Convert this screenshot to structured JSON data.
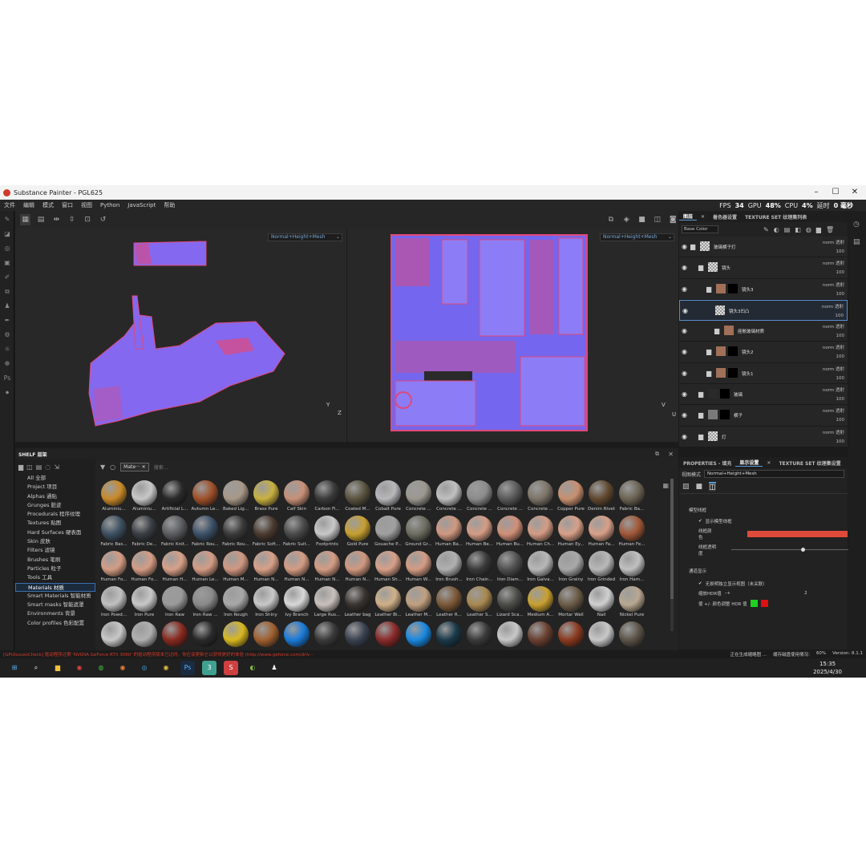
{
  "window": {
    "title": "Substance Painter - PGL625",
    "min": "–",
    "max": "☐",
    "close": "✕"
  },
  "menu": [
    "文件",
    "编辑",
    "模式",
    "窗口",
    "视图",
    "Python",
    "JavaScript",
    "帮助"
  ],
  "stats": {
    "fps_label": "FPS",
    "fps": "34",
    "gpu_label": "GPU",
    "gpu": "48%",
    "cpu_label": "CPU",
    "cpu": "4%",
    "latency_label": "延时",
    "latency": "0 毫秒"
  },
  "viewport": {
    "left_mode": "Normal+Height+Mesh",
    "right_mode": "Normal+Height+Mesh",
    "axis_y": "Y",
    "axis_z": "Z",
    "axis_u": "U",
    "axis_v": "V"
  },
  "shelf": {
    "title": "SHELF 层架",
    "filter_chip": "Mate···",
    "search_placeholder": "搜索...",
    "categories": [
      "All 全部",
      "Project 项目",
      "Alphas 通贴",
      "Grunges 脏迹",
      "Procedurals 程序纹理",
      "Textures 贴图",
      "Hard Surfaces 硬表面",
      "Skin 皮肤",
      "Filters 滤镜",
      "Brushes 笔刷",
      "Particles 粒子",
      "Tools 工具",
      "Materials 材质",
      "Smart Materials 智能材质",
      "Smart masks 智能遮罩",
      "Environments 背景",
      "Color profiles 色彩配置"
    ],
    "selected_category": "Materials 材质",
    "materials": [
      {
        "name": "Aluminiu...",
        "color": "#c98a2a"
      },
      {
        "name": "Aluminiu...",
        "color": "#c8c8c8"
      },
      {
        "name": "Artificial L...",
        "color": "#2a2a2a"
      },
      {
        "name": "Autumn Le...",
        "color": "#a0502a"
      },
      {
        "name": "Baked Lig...",
        "color": "#a89888"
      },
      {
        "name": "Brass Pure",
        "color": "#c8b040"
      },
      {
        "name": "Calf Skin",
        "color": "#c89078"
      },
      {
        "name": "Carbon Fi...",
        "color": "#3a3a3a"
      },
      {
        "name": "Coated M...",
        "color": "#5a5440"
      },
      {
        "name": "Cobalt Pure",
        "color": "#b8b8bc"
      },
      {
        "name": "Concrete ...",
        "color": "#9c9890"
      },
      {
        "name": "Concrete ...",
        "color": "#c0c0c0"
      },
      {
        "name": "Concrete ...",
        "color": "#8c8c8c"
      },
      {
        "name": "Concrete ...",
        "color": "#5a5a5a"
      },
      {
        "name": "Concrete ...",
        "color": "#7c7468"
      },
      {
        "name": "Copper Pure",
        "color": "#c89070"
      },
      {
        "name": "Denim Rivet",
        "color": "#604830"
      },
      {
        "name": "Fabric Ba...",
        "color": "#6c6454"
      },
      {
        "name": "Fabric Bas...",
        "color": "#3c5060"
      },
      {
        "name": "Fabric De...",
        "color": "#3a3e44"
      },
      {
        "name": "Fabric Knit...",
        "color": "#5a5c60"
      },
      {
        "name": "Fabric Rou...",
        "color": "#3c5068"
      },
      {
        "name": "Fabric Rou...",
        "color": "#3a3a3a"
      },
      {
        "name": "Fabric Soft...",
        "color": "#4a3a30"
      },
      {
        "name": "Fabric Suit...",
        "color": "#4a4a4a"
      },
      {
        "name": "Footprints",
        "color": "#c8c8c8"
      },
      {
        "name": "Gold Pure",
        "color": "#c8a030"
      },
      {
        "name": "Gouache P...",
        "color": "#a0a0a0"
      },
      {
        "name": "Ground Gr...",
        "color": "#6c6c60"
      },
      {
        "name": "Human Ba...",
        "color": "#d09880"
      },
      {
        "name": "Human Be...",
        "color": "#d49c84"
      },
      {
        "name": "Human Bu...",
        "color": "#d09078"
      },
      {
        "name": "Human Ch...",
        "color": "#d49c84"
      },
      {
        "name": "Human Ey...",
        "color": "#d8a088"
      },
      {
        "name": "Human Fa...",
        "color": "#d8a088"
      },
      {
        "name": "Human Fe...",
        "color": "#a05838"
      },
      {
        "name": "Human Fo...",
        "color": "#d49c84"
      },
      {
        "name": "Human Fo...",
        "color": "#d49c84"
      },
      {
        "name": "Human H...",
        "color": "#d8a088"
      },
      {
        "name": "Human Le...",
        "color": "#d49c84"
      },
      {
        "name": "Human M...",
        "color": "#d09880"
      },
      {
        "name": "Human N...",
        "color": "#d8a088"
      },
      {
        "name": "Human N...",
        "color": "#d49c84"
      },
      {
        "name": "Human N...",
        "color": "#d49c84"
      },
      {
        "name": "Human N...",
        "color": "#d09880"
      },
      {
        "name": "Human Sh...",
        "color": "#d8a088"
      },
      {
        "name": "Human W...",
        "color": "#d49c84"
      },
      {
        "name": "Iron Brush...",
        "color": "#b0b0b0"
      },
      {
        "name": "Iron Chain...",
        "color": "#3a3a3a"
      },
      {
        "name": "Iron Diam...",
        "color": "#505050"
      },
      {
        "name": "Iron Galva...",
        "color": "#b8b8b8"
      },
      {
        "name": "Iron Grainy",
        "color": "#a8a8a8"
      },
      {
        "name": "Iron Grinded",
        "color": "#b8b8b8"
      },
      {
        "name": "Iron Ham...",
        "color": "#c0c0c0"
      },
      {
        "name": "Iron Powd...",
        "color": "#c0c0c0"
      },
      {
        "name": "Iron Pure",
        "color": "#c8c8c8"
      },
      {
        "name": "Iron Raw",
        "color": "#9a9a9a"
      },
      {
        "name": "Iron Raw ...",
        "color": "#8a8a8a"
      },
      {
        "name": "Iron Rough",
        "color": "#a8a8a8"
      },
      {
        "name": "Iron Shiny",
        "color": "#c8c8c8"
      },
      {
        "name": "Ivy Branch",
        "color": "#d8d8d8"
      },
      {
        "name": "Large Rus...",
        "color": "#c8c0bc"
      },
      {
        "name": "Leather bag",
        "color": "#3a3430"
      },
      {
        "name": "Leather Bi...",
        "color": "#d0b088"
      },
      {
        "name": "Leather M...",
        "color": "#c0a080"
      },
      {
        "name": "Leather R...",
        "color": "#7c5838"
      },
      {
        "name": "Leather S...",
        "color": "#a88850"
      },
      {
        "name": "Lizard Sca...",
        "color": "#4c4c48"
      },
      {
        "name": "Medium A...",
        "color": "#c8a030"
      },
      {
        "name": "Mortar Wall",
        "color": "#6c5c48"
      },
      {
        "name": "Nail",
        "color": "#d0d0d0"
      },
      {
        "name": "Nickel Pure",
        "color": "#b8a890"
      },
      {
        "name": "",
        "color": "#c8c8c8"
      },
      {
        "name": "",
        "color": "#b0b0b0"
      },
      {
        "name": "",
        "color": "#8a2a20"
      },
      {
        "name": "",
        "color": "#2a2a2a"
      },
      {
        "name": "",
        "color": "#d8b820"
      },
      {
        "name": "",
        "color": "#a06030"
      },
      {
        "name": "",
        "color": "#1a7ad8"
      },
      {
        "name": "",
        "color": "#3a3a3a"
      },
      {
        "name": "",
        "color": "#3a4250"
      },
      {
        "name": "",
        "color": "#8a2a2a"
      },
      {
        "name": "",
        "color": "#1a88e0"
      },
      {
        "name": "",
        "color": "#1a3a4a"
      },
      {
        "name": "",
        "color": "#3a3a3a"
      },
      {
        "name": "",
        "color": "#c8c8c8"
      },
      {
        "name": "",
        "color": "#6a4030"
      },
      {
        "name": "",
        "color": "#8a3a20"
      },
      {
        "name": "",
        "color": "#c8c8c8"
      },
      {
        "name": "",
        "color": "#5c5448"
      }
    ]
  },
  "layers_panel": {
    "tabs": [
      "图层",
      "着色器设置",
      "TEXTURE SET 纹理集列表"
    ],
    "channel": "Base Color",
    "layers": [
      {
        "name": "玻璃横子灯",
        "indent": 0,
        "type": "group",
        "thumb": "#888",
        "mask": "",
        "blend": "norm 透射",
        "opacity": "100"
      },
      {
        "name": "镜头",
        "indent": 1,
        "type": "group",
        "thumb": "#888",
        "mask": "",
        "blend": "norm 透射",
        "opacity": "100"
      },
      {
        "name": "镜头3",
        "indent": 2,
        "type": "group",
        "thumb": "#a07058",
        "mask": "#000",
        "blend": "norm 透射",
        "opacity": "100"
      },
      {
        "name": "镜头3凹凸",
        "indent": 3,
        "type": "fill",
        "thumb": "#888",
        "mask": "",
        "blend": "norm 透射",
        "opacity": "100",
        "selected": true
      },
      {
        "name": "座舱玻璃材质",
        "indent": 3,
        "type": "group",
        "thumb": "#a07058",
        "mask": "",
        "blend": "norm 透射",
        "opacity": "100"
      },
      {
        "name": "镜头2",
        "indent": 2,
        "type": "group",
        "thumb": "#a07058",
        "mask": "#000",
        "blend": "norm 透射",
        "opacity": "100"
      },
      {
        "name": "镜头1",
        "indent": 2,
        "type": "group",
        "thumb": "#a07058",
        "mask": "#000",
        "blend": "norm 透射",
        "opacity": "100"
      },
      {
        "name": "玻璃",
        "indent": 1,
        "type": "group",
        "thumb": "#2a2a2a",
        "mask": "#000",
        "blend": "norm 透射",
        "opacity": "100"
      },
      {
        "name": "横子",
        "indent": 1,
        "type": "group",
        "thumb": "#7a7a7a",
        "mask": "#000",
        "blend": "norm 透射",
        "opacity": "100"
      },
      {
        "name": "灯",
        "indent": 1,
        "type": "group",
        "thumb": "#888",
        "mask": "",
        "blend": "norm 透射",
        "opacity": "100"
      }
    ]
  },
  "properties_panel": {
    "tabs": [
      "PROPERTIES - 填充",
      "显示设置",
      "TEXTURE SET 纹理集设置"
    ],
    "view_mode_label": "视图模式",
    "view_mode": "Normal+Height+Mesh",
    "section_wireframe": "模型线框",
    "show_wireframe": "显示模型线框",
    "wire_color_label": "线框颜色",
    "wire_color": "#e04a3a",
    "wire_opacity_label": "线框透明度",
    "wire_opacity": 0.6,
    "section_channel": "通道显示",
    "channel_isolate": "无损明独立显示视图（未关联）",
    "hdr_label": "缩放HDR值",
    "hdr_value": "2",
    "clamp_label": "使 +/- 颜色调整 HDR 值",
    "clamp_colors": [
      "#20d020",
      "#e01010"
    ]
  },
  "statusbar": {
    "error": "[GPUIssuesCheck] 驱动程序过期  'NVIDIA GeForce RTX 3060'  的驱动程序版本已过时。你应该更新它以获得更好的体验 (http://www.geforce.com/driv···",
    "baking": "正在生成缩略图 ...",
    "cache_label": "缓存磁盘使用情况:",
    "cache": "60%",
    "version": "Version: 8.1.1"
  },
  "taskbar": {
    "time": "15:35",
    "date": "2025/4/30"
  }
}
